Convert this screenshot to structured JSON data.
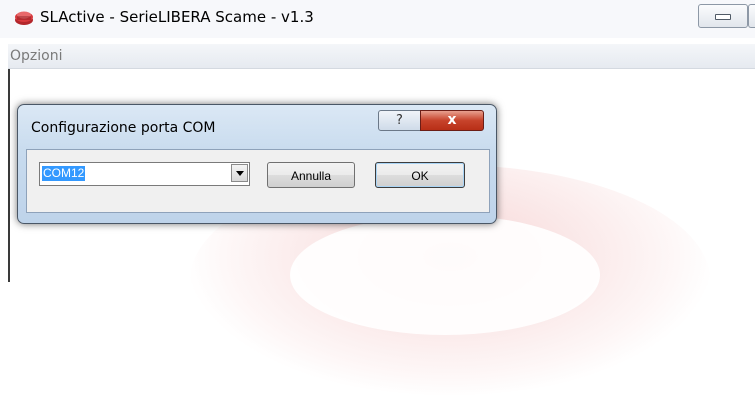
{
  "window": {
    "title": "SLActive - SerieLIBERA Scame - v1.3",
    "icon": "app-logo-icon"
  },
  "menubar": {
    "items": [
      {
        "label": "Opzioni"
      }
    ]
  },
  "dialog": {
    "title": "Configurazione porta COM",
    "help_label": "?",
    "close_label": "x",
    "port_select": {
      "value": "COM12",
      "selected": true
    },
    "cancel_label": "Annulla",
    "ok_label": "OK"
  },
  "colors": {
    "selection": "#3399ff",
    "close_button": "#c7432b",
    "dialog_frame": "#c8dbee"
  }
}
